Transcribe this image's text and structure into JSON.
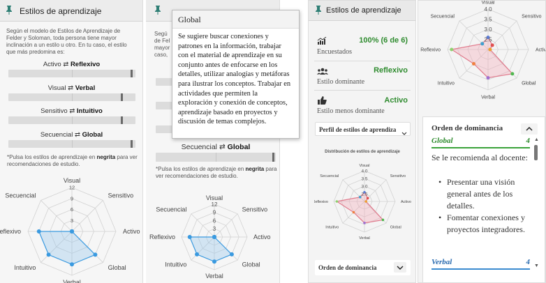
{
  "header": {
    "title": "Estilos de aprendizaje"
  },
  "intro": "Según el modelo de Estilos de Aprendizaje de Felder y Soloman, toda persona tiene mayor inclinación a un estilo u otro. En tu caso, el estilo que más predomina es:",
  "intro_clipped": [
    "Segú",
    "de Fel",
    "mayor",
    "caso,"
  ],
  "dimensions": [
    {
      "left": "Activo",
      "arrow": "⇄",
      "right": "Reflexivo",
      "bold": "right",
      "position": 0.98
    },
    {
      "left": "Visual",
      "arrow": "⇄",
      "right": "Verbal",
      "bold": "right",
      "position": 0.9
    },
    {
      "left": "Sensitivo",
      "arrow": "⇄",
      "right": "Intuitivo",
      "bold": "right",
      "position": 0.9
    },
    {
      "left": "Secuencial",
      "arrow": "⇄",
      "right": "Global",
      "bold": "right",
      "position": 0.98
    }
  ],
  "note": {
    "before": "*Pulsa los estilos de aprendizaje en ",
    "bold": "negrita",
    "after": " para ver recomendaciones de estudio."
  },
  "radar": {
    "axes": [
      "Visual",
      "Sensitivo",
      "Activo",
      "Global",
      "Verbal",
      "Intuitivo",
      "Reflexivo",
      "Secuencial"
    ],
    "ticks": [
      "3",
      "6",
      "9",
      "12"
    ],
    "max": 12,
    "values": [
      0,
      0,
      0,
      9,
      9,
      9,
      9,
      0
    ]
  },
  "tooltip": {
    "title": "Global",
    "text": "Se sugiere buscar conexiones y patrones en la información, trabajar con el material de aprendizaje en su conjunto antes de enfocarse en los detalles, utilizar analogías y metáforas para ilustrar los conceptos. Trabajar en actividades que permiten la exploración y conexión de conceptos, aprendizaje basado en proyectos y discusión de temas complejos."
  },
  "stats": [
    {
      "icon": "bar-chart-icon",
      "value": "100% (6 de 6)",
      "label": "Encuestados"
    },
    {
      "icon": "users-icon",
      "value": "Reflexivo",
      "label": "Estilo dominante"
    },
    {
      "icon": "thumbs-up-icon",
      "value": "Activo",
      "label": "Estilo menos dominante"
    }
  ],
  "profile_dropdown": {
    "label": "Perfil de estilos de aprendiza"
  },
  "mini_chart": {
    "title": "Distribución de estilos de aprendizaje"
  },
  "profile_radar": {
    "axes": [
      "Visual",
      "Sensitivo",
      "Activo",
      "Global",
      "Verbal",
      "Intuitivo",
      "Reflexivo",
      "Secuencial"
    ],
    "ticks": [
      "2.5",
      "3.0",
      "3.5",
      "4.0"
    ],
    "min": 2,
    "max": 4,
    "values": [
      2.6,
      2.3,
      2.1,
      3.7,
      3.4,
      3.0,
      3.8,
      2.4
    ],
    "point_colors": [
      "#5b7bd5",
      "#e05050",
      "#f0a030",
      "#50b850",
      "#a070d0",
      "#f08040",
      "#90d070",
      "#40a0d0"
    ]
  },
  "dominance": {
    "title": "Orden de dominancia",
    "first": {
      "name": "Global",
      "rank": "4",
      "color": "#2e8b2e"
    },
    "intro": "Se le recomienda al docente:",
    "recommendations": [
      "Presentar una visión general antes de los detalles.",
      "Fomentar conexiones y proyectos integradores."
    ],
    "second": {
      "name": "Verbal",
      "rank": "4",
      "color": "#2b6cb0"
    }
  },
  "colors": {
    "accent_blue": "#3a9ae0",
    "accent_green": "#2e8b2e",
    "profile_fill": "#f3a6b4"
  }
}
